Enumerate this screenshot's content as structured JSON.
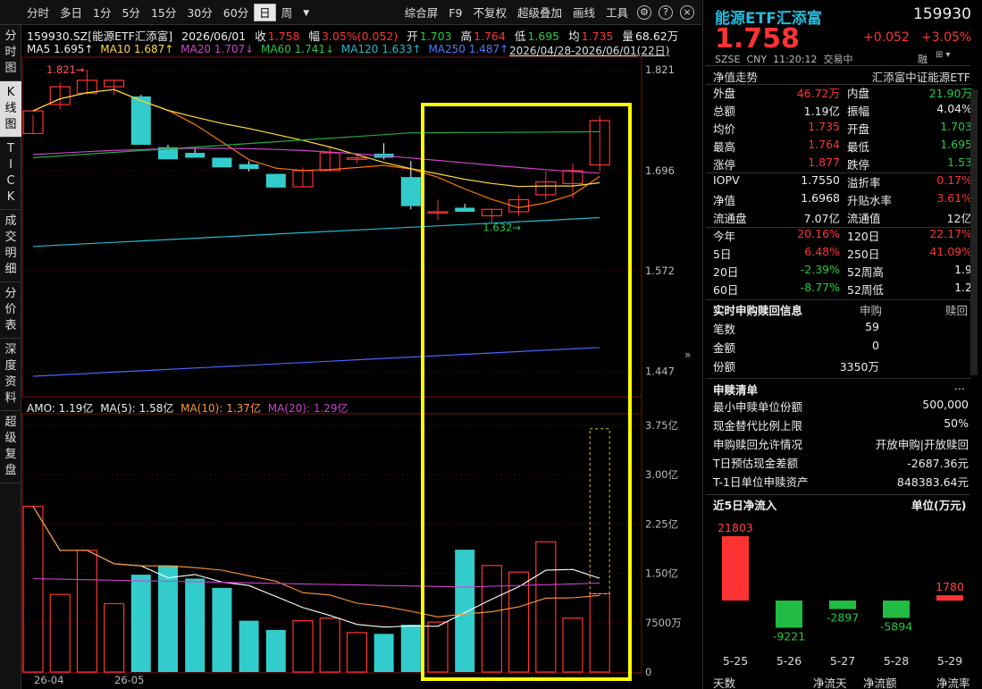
{
  "toolbar": {
    "left": [
      "分时",
      "多日",
      "1分",
      "5分",
      "15分",
      "30分",
      "60分",
      "日",
      "周"
    ],
    "active": "日",
    "right": [
      "综合屏",
      "F9",
      "不复权",
      "超级叠加",
      "画线",
      "工具"
    ]
  },
  "sidebar": [
    {
      "label": "分时图"
    },
    {
      "label": "K线图",
      "active": true
    },
    {
      "label": "TICK"
    },
    {
      "label": "成交明细"
    },
    {
      "label": "分价表"
    },
    {
      "label": "深度资料"
    },
    {
      "label": "超级复盘"
    }
  ],
  "info": {
    "code": "159930.SZ[能源ETF汇添富]",
    "date": "2026/06/01",
    "close_label": "收",
    "close": "1.758",
    "range_label": "幅",
    "range": "3.05%(0.052)",
    "open_label": "开",
    "open": "1.703",
    "high_label": "高",
    "high": "1.764",
    "low_label": "低",
    "low": "1.695",
    "mid_label": "均",
    "mid": "1.735",
    "amount_label": "量",
    "amount": "68.62万"
  },
  "ma": {
    "ma5": "MA5 1.695↑",
    "ma10": "MA10 1.687↑",
    "ma20": "MA20 1.707↓",
    "ma60": "MA60 1.741↓",
    "ma120": "MA120 1.633↑",
    "ma250": "MA250 1.487↑"
  },
  "date_range": "2026/04/28-2026/06/01(22日)",
  "price_axis": [
    "1.821",
    "1.696",
    "1.572",
    "1.447"
  ],
  "high_marker": "1.821→",
  "low_marker": "1.632→",
  "amo": {
    "amo": "AMO: 1.19亿",
    "ma5": "MA(5): 1.58亿",
    "ma10": "MA(10): 1.37亿",
    "ma20": "MA(20): 1.29亿"
  },
  "vol_axis": [
    "3.75亿",
    "3.00亿",
    "2.25亿",
    "1.50亿",
    "7500万",
    "0"
  ],
  "x_axis": [
    "26-04",
    "26-05"
  ],
  "colors": {
    "up": "#ff3333",
    "down": "#33cccc",
    "highlight": "#ffff00"
  },
  "chart_data": {
    "type": "candlestick",
    "ylim": [
      1.42,
      1.83
    ],
    "candles": [
      {
        "o": 1.742,
        "h": 1.765,
        "l": 1.742,
        "c": 1.77
      },
      {
        "o": 1.778,
        "h": 1.805,
        "l": 1.772,
        "c": 1.8
      },
      {
        "o": 1.792,
        "h": 1.821,
        "l": 1.79,
        "c": 1.808
      },
      {
        "o": 1.8,
        "h": 1.808,
        "l": 1.79,
        "c": 1.808
      },
      {
        "o": 1.788,
        "h": 1.79,
        "l": 1.728,
        "c": 1.728
      },
      {
        "o": 1.725,
        "h": 1.728,
        "l": 1.71,
        "c": 1.71
      },
      {
        "o": 1.718,
        "h": 1.724,
        "l": 1.712,
        "c": 1.712
      },
      {
        "o": 1.712,
        "h": 1.712,
        "l": 1.7,
        "c": 1.7
      },
      {
        "o": 1.704,
        "h": 1.708,
        "l": 1.695,
        "c": 1.698
      },
      {
        "o": 1.692,
        "h": 1.692,
        "l": 1.675,
        "c": 1.675
      },
      {
        "o": 1.676,
        "h": 1.7,
        "l": 1.676,
        "c": 1.696
      },
      {
        "o": 1.696,
        "h": 1.725,
        "l": 1.695,
        "c": 1.718
      },
      {
        "o": 1.71,
        "h": 1.716,
        "l": 1.705,
        "c": 1.712
      },
      {
        "o": 1.717,
        "h": 1.73,
        "l": 1.71,
        "c": 1.712
      },
      {
        "o": 1.688,
        "h": 1.708,
        "l": 1.648,
        "c": 1.652
      },
      {
        "o": 1.645,
        "h": 1.66,
        "l": 1.635,
        "c": 1.645
      },
      {
        "o": 1.65,
        "h": 1.655,
        "l": 1.645,
        "c": 1.645
      },
      {
        "o": 1.64,
        "h": 1.648,
        "l": 1.632,
        "c": 1.648
      },
      {
        "o": 1.645,
        "h": 1.666,
        "l": 1.64,
        "c": 1.66
      },
      {
        "o": 1.666,
        "h": 1.695,
        "l": 1.66,
        "c": 1.682
      },
      {
        "o": 1.68,
        "h": 1.705,
        "l": 1.662,
        "c": 1.696
      },
      {
        "o": 1.703,
        "h": 1.764,
        "l": 1.695,
        "c": 1.758
      }
    ],
    "volumes_yi": [
      2.52,
      1.18,
      1.85,
      1.04,
      1.48,
      1.62,
      1.42,
      1.28,
      0.78,
      0.64,
      0.78,
      0.82,
      0.6,
      0.58,
      0.72,
      0.76,
      1.86,
      1.62,
      1.52,
      1.98,
      0.82,
      1.19
    ],
    "vol_ylim": [
      0,
      3.9
    ]
  },
  "rp": {
    "title": "能源ETF汇添富",
    "code": "159930",
    "price": "1.758",
    "change": "+0.052",
    "pct": "+3.05%",
    "market": "SZSE",
    "currency": "CNY",
    "time": "11:20:12",
    "status": "交易中",
    "rong": "融",
    "nav_trend_label": "净值走势",
    "index_name": "汇添富中证能源ETF",
    "rows1": [
      {
        "l1": "外盘",
        "v1": "46.72万",
        "c1": "red",
        "l2": "内盘",
        "v2": "21.90万",
        "c2": "green"
      },
      {
        "l1": "总额",
        "v1": "1.19亿",
        "c1": "white",
        "l2": "振幅",
        "v2": "4.04%",
        "c2": "white"
      },
      {
        "l1": "均价",
        "v1": "1.735",
        "c1": "red",
        "l2": "开盘",
        "v2": "1.703",
        "c2": "green"
      },
      {
        "l1": "最高",
        "v1": "1.764",
        "c1": "red",
        "l2": "最低",
        "v2": "1.695",
        "c2": "green"
      },
      {
        "l1": "涨停",
        "v1": "1.877",
        "c1": "red",
        "l2": "跌停",
        "v2": "1.53",
        "c2": "green"
      }
    ],
    "rows2": [
      {
        "l1": "IOPV",
        "v1": "1.7550",
        "c1": "white",
        "l2": "溢折率",
        "v2": "0.17%",
        "c2": "red"
      },
      {
        "l1": "净值",
        "v1": "1.6968",
        "c1": "white",
        "l2": "升贴水率",
        "v2": "3.61%",
        "c2": "red"
      },
      {
        "l1": "流通盘",
        "v1": "7.07亿",
        "c1": "white",
        "l2": "流通值",
        "v2": "12亿",
        "c2": "white"
      }
    ],
    "rows3": [
      {
        "l1": "今年",
        "v1": "20.16%",
        "c1": "red",
        "l2": "120日",
        "v2": "22.17%",
        "c2": "red"
      },
      {
        "l1": "5日",
        "v1": "6.48%",
        "c1": "red",
        "l2": "250日",
        "v2": "41.09%",
        "c2": "red"
      },
      {
        "l1": "20日",
        "v1": "-2.39%",
        "c1": "green",
        "l2": "52周高",
        "v2": "1.9",
        "c2": "white"
      },
      {
        "l1": "60日",
        "v1": "-8.77%",
        "c1": "green",
        "l2": "52周低",
        "v2": "1.2",
        "c2": "white"
      }
    ],
    "sub_title": "实时申购赎回信息",
    "sub_col1": "申购",
    "sub_col2": "赎回",
    "sub_rows": [
      {
        "k": "笔数",
        "v": "59"
      },
      {
        "k": "金额",
        "v": "0"
      },
      {
        "k": "份额",
        "v": "3350万"
      }
    ],
    "list_title": "申赎清单",
    "list_more": "...",
    "list_rows": [
      {
        "k": "最小申赎单位份额",
        "v": "500,000"
      },
      {
        "k": "现金替代比例上限",
        "v": "50%"
      },
      {
        "k": "申购赎回允许情况",
        "v": "开放申购|开放赎回"
      },
      {
        "k": "T日预估现金差额",
        "v": "-2687.36元"
      },
      {
        "k": "T-1日单位申赎资产",
        "v": "848383.64元"
      }
    ],
    "flow_title": "近5日净流入",
    "flow_unit": "单位(万元)",
    "flows": [
      {
        "date": "5-25",
        "value": 21803
      },
      {
        "date": "5-26",
        "value": -9221
      },
      {
        "date": "5-27",
        "value": -2897
      },
      {
        "date": "5-28",
        "value": -5894
      },
      {
        "date": "5-29",
        "value": 1780
      }
    ],
    "footer": [
      "天数",
      "净流天",
      "净流额",
      "净流率"
    ]
  }
}
